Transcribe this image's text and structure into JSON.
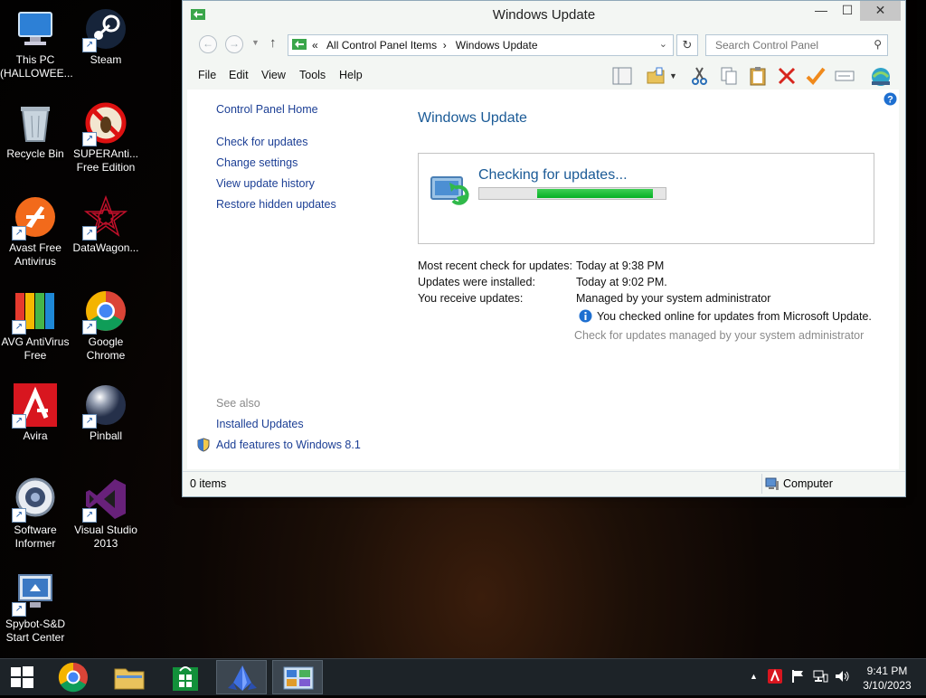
{
  "desktop": {
    "icons": [
      {
        "label": "This PC (HALLOWEE...",
        "icon": "this-pc-icon"
      },
      {
        "label": "Steam",
        "icon": "steam-icon"
      },
      {
        "label": "Recycle Bin",
        "icon": "recycle-bin-icon"
      },
      {
        "label": "SUPERAnti... Free Edition",
        "icon": "superantispyware-icon"
      },
      {
        "label": "Avast Free Antivirus",
        "icon": "avast-icon"
      },
      {
        "label": "DataWagon...",
        "icon": "datawagon-icon"
      },
      {
        "label": "AVG AntiVirus Free",
        "icon": "avg-icon"
      },
      {
        "label": "Google Chrome",
        "icon": "chrome-icon"
      },
      {
        "label": "Avira",
        "icon": "avira-icon"
      },
      {
        "label": "Pinball",
        "icon": "pinball-icon"
      },
      {
        "label": "Software Informer",
        "icon": "software-informer-icon"
      },
      {
        "label": "Visual Studio 2013",
        "icon": "visual-studio-icon"
      },
      {
        "label": "Spybot-S&D Start Center",
        "icon": "spybot-icon"
      }
    ]
  },
  "window": {
    "title": "Windows Update",
    "controls": {
      "minimize": "—",
      "maximize": "☐",
      "close": "✕"
    },
    "address": {
      "overflow": "«",
      "crumbs": [
        "All Control Panel Items",
        "Windows Update"
      ],
      "separator": "›"
    },
    "search_placeholder": "Search Control Panel",
    "menu": [
      "File",
      "Edit",
      "View",
      "Tools",
      "Help"
    ],
    "sidebar": {
      "home": "Control Panel Home",
      "links": [
        "Check for updates",
        "Change settings",
        "View update history",
        "Restore hidden updates"
      ],
      "see_also": "See also",
      "see_also_links": [
        "Installed Updates",
        "Add features to Windows 8.1"
      ]
    },
    "main": {
      "heading": "Windows Update",
      "status_text": "Checking for updates...",
      "progress": {
        "start_fraction": 0.31,
        "end_fraction": 0.93
      },
      "info": [
        {
          "key": "Most recent check for updates:",
          "value": "Today at 9:38 PM"
        },
        {
          "key": "Updates were installed:",
          "value": "Today at 9:02 PM."
        },
        {
          "key": "You receive updates:",
          "value": "Managed by your system administrator"
        }
      ],
      "online_note": "You checked online for updates from Microsoft Update.",
      "managed_link": "Check for updates managed by your system administrator"
    },
    "statusbar": {
      "items": "0 items",
      "location": "Computer"
    }
  },
  "taskbar": {
    "time": "9:41 PM",
    "date": "3/10/2023",
    "tray_arrow": "▲"
  },
  "colors": {
    "accent": "#1a5a96",
    "link": "#1c3f95",
    "progress": "#06b025",
    "taskbar": "#1d2328"
  }
}
